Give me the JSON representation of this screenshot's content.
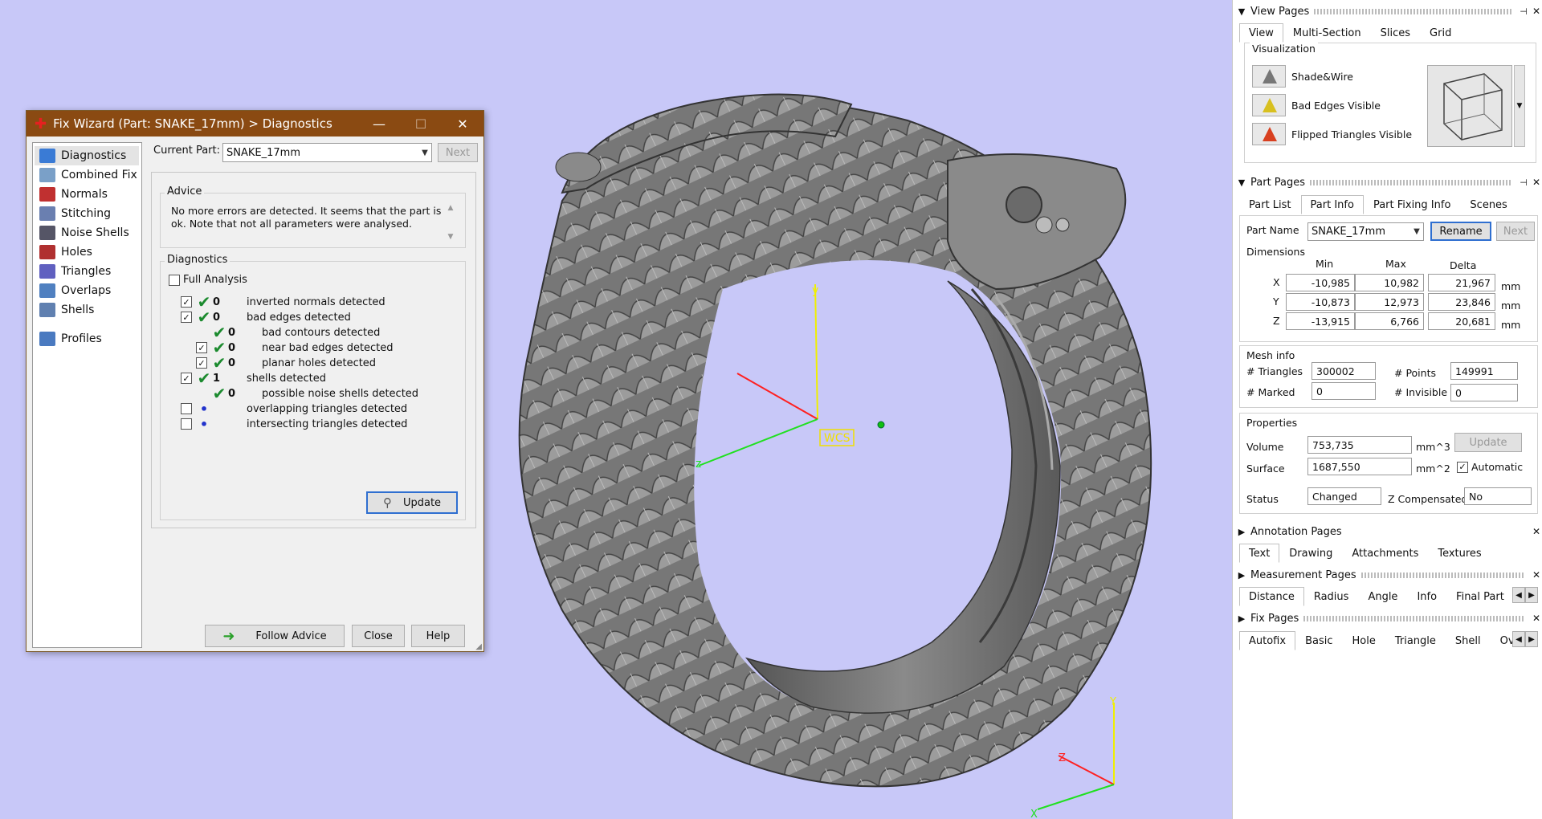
{
  "wizard": {
    "title": "Fix Wizard (Part: SNAKE_17mm) > Diagnostics",
    "nav": [
      {
        "label": "Diagnostics",
        "icon": "magnifier-icon",
        "color": "#3a7bd5"
      },
      {
        "label": "Combined Fix",
        "icon": "cube-icon",
        "color": "#7aa0c8"
      },
      {
        "label": "Normals",
        "icon": "normals-cube-icon",
        "color": "#c03030"
      },
      {
        "label": "Stitching",
        "icon": "stitching-cube-icon",
        "color": "#6a7fb0"
      },
      {
        "label": "Noise Shells",
        "icon": "dice-icon",
        "color": "#556"
      },
      {
        "label": "Holes",
        "icon": "holes-cube-icon",
        "color": "#b03030"
      },
      {
        "label": "Triangles",
        "icon": "triangles-cube-icon",
        "color": "#6060c0"
      },
      {
        "label": "Overlaps",
        "icon": "overlaps-cube-icon",
        "color": "#5080c0"
      },
      {
        "label": "Shells",
        "icon": "shells-cube-icon",
        "color": "#6080b0"
      },
      {
        "label": "Profiles",
        "icon": "document-icon",
        "color": "#4a7ac0"
      }
    ],
    "current_part_label": "Current Part:",
    "current_part_value": "SNAKE_17mm",
    "next_label": "Next",
    "advice_label": "Advice",
    "advice_text": "No more errors are detected. It seems that the part is ok. Note that not all parameters were analysed.",
    "diagnostics_label": "Diagnostics",
    "full_analysis_label": "Full Analysis",
    "rows": [
      {
        "checked": true,
        "status": "check",
        "count": "0",
        "label": "inverted normals detected",
        "indent": 0
      },
      {
        "checked": true,
        "status": "check",
        "count": "0",
        "label": "bad edges detected",
        "indent": 0
      },
      {
        "checked": null,
        "status": "check",
        "count": "0",
        "label": "bad contours detected",
        "indent": 1
      },
      {
        "checked": true,
        "status": "check",
        "count": "0",
        "label": "near bad edges detected",
        "indent": 1
      },
      {
        "checked": true,
        "status": "check",
        "count": "0",
        "label": "planar holes detected",
        "indent": 1
      },
      {
        "checked": true,
        "status": "check",
        "count": "1",
        "label": "shells detected",
        "indent": 0
      },
      {
        "checked": null,
        "status": "check",
        "count": "0",
        "label": "possible noise shells detected",
        "indent": 1
      },
      {
        "checked": false,
        "status": "dot",
        "count": "",
        "label": "overlapping triangles detected",
        "indent": 0
      },
      {
        "checked": false,
        "status": "dot",
        "count": "",
        "label": "intersecting triangles detected",
        "indent": 0
      }
    ],
    "update_label": "Update",
    "follow_advice_label": "Follow Advice",
    "close_label": "Close",
    "help_label": "Help"
  },
  "viewport": {
    "wcs_label": "WCS",
    "axis_y": "y",
    "axis_x": "z",
    "mini_axis_y": "Y",
    "mini_axis_z": "Z",
    "mini_axis_x": "X"
  },
  "view_pages": {
    "title": "View Pages",
    "tabs": [
      "View",
      "Multi-Section",
      "Slices",
      "Grid"
    ],
    "visualization_label": "Visualization",
    "items": [
      "Shade&Wire",
      "Bad Edges Visible",
      "Flipped Triangles Visible"
    ]
  },
  "part_pages": {
    "title": "Part Pages",
    "tabs": [
      "Part List",
      "Part Info",
      "Part Fixing Info",
      "Scenes"
    ],
    "part_name_label": "Part Name",
    "part_name_value": "SNAKE_17mm",
    "rename_label": "Rename",
    "next_label": "Next",
    "dimensions_label": "Dimensions",
    "col_min": "Min",
    "col_max": "Max",
    "col_delta": "Delta",
    "unit": "mm",
    "dims": [
      {
        "axis": "X",
        "min": "-10,985",
        "max": "10,982",
        "delta": "21,967"
      },
      {
        "axis": "Y",
        "min": "-10,873",
        "max": "12,973",
        "delta": "23,846"
      },
      {
        "axis": "Z",
        "min": "-13,915",
        "max": "6,766",
        "delta": "20,681"
      }
    ],
    "mesh_info_label": "Mesh info",
    "triangles_label": "# Triangles",
    "triangles_value": "300002",
    "points_label": "# Points",
    "points_value": "149991",
    "marked_label": "# Marked",
    "marked_value": "0",
    "invisible_label": "# Invisible",
    "invisible_value": "0",
    "properties_label": "Properties",
    "volume_label": "Volume",
    "volume_value": "753,735",
    "volume_unit": "mm^3",
    "surface_label": "Surface",
    "surface_value": "1687,550",
    "surface_unit": "mm^2",
    "update_label": "Update",
    "automatic_label": "Automatic",
    "status_label": "Status",
    "status_value": "Changed",
    "zcomp_label": "Z Compensated",
    "zcomp_value": "No"
  },
  "annotation_pages": {
    "title": "Annotation Pages",
    "tabs": [
      "Text",
      "Drawing",
      "Attachments",
      "Textures"
    ]
  },
  "measurement_pages": {
    "title": "Measurement Pages",
    "tabs": [
      "Distance",
      "Radius",
      "Angle",
      "Info",
      "Final Part"
    ]
  },
  "fix_pages": {
    "title": "Fix Pages",
    "tabs": [
      "Autofix",
      "Basic",
      "Hole",
      "Triangle",
      "Shell",
      "Over"
    ]
  }
}
